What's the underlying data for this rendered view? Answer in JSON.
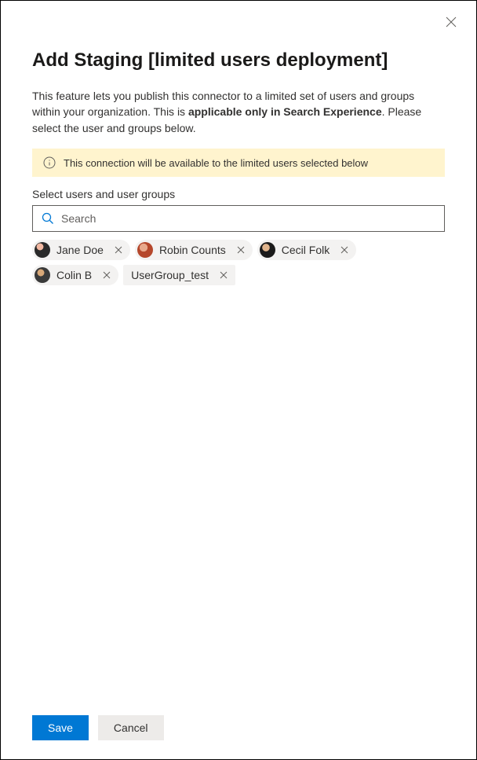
{
  "title": "Add Staging [limited users deployment]",
  "description": {
    "prefix": "This feature lets you publish this connector to a limited set of users and groups within your organization. This is ",
    "bold": "applicable only in Search Experience",
    "suffix": ". Please select the user and groups below."
  },
  "banner": {
    "text": "This connection will be available to the limited users selected below"
  },
  "section_label": "Select users and user groups",
  "search": {
    "placeholder": "Search",
    "value": ""
  },
  "selected": [
    {
      "type": "user",
      "label": "Jane Doe",
      "avatar_class": "av1"
    },
    {
      "type": "user",
      "label": "Robin Counts",
      "avatar_class": "av2"
    },
    {
      "type": "user",
      "label": "Cecil Folk",
      "avatar_class": "av3"
    },
    {
      "type": "user",
      "label": "Colin B",
      "avatar_class": "av4"
    },
    {
      "type": "group",
      "label": "UserGroup_test"
    }
  ],
  "actions": {
    "save": "Save",
    "cancel": "Cancel"
  }
}
